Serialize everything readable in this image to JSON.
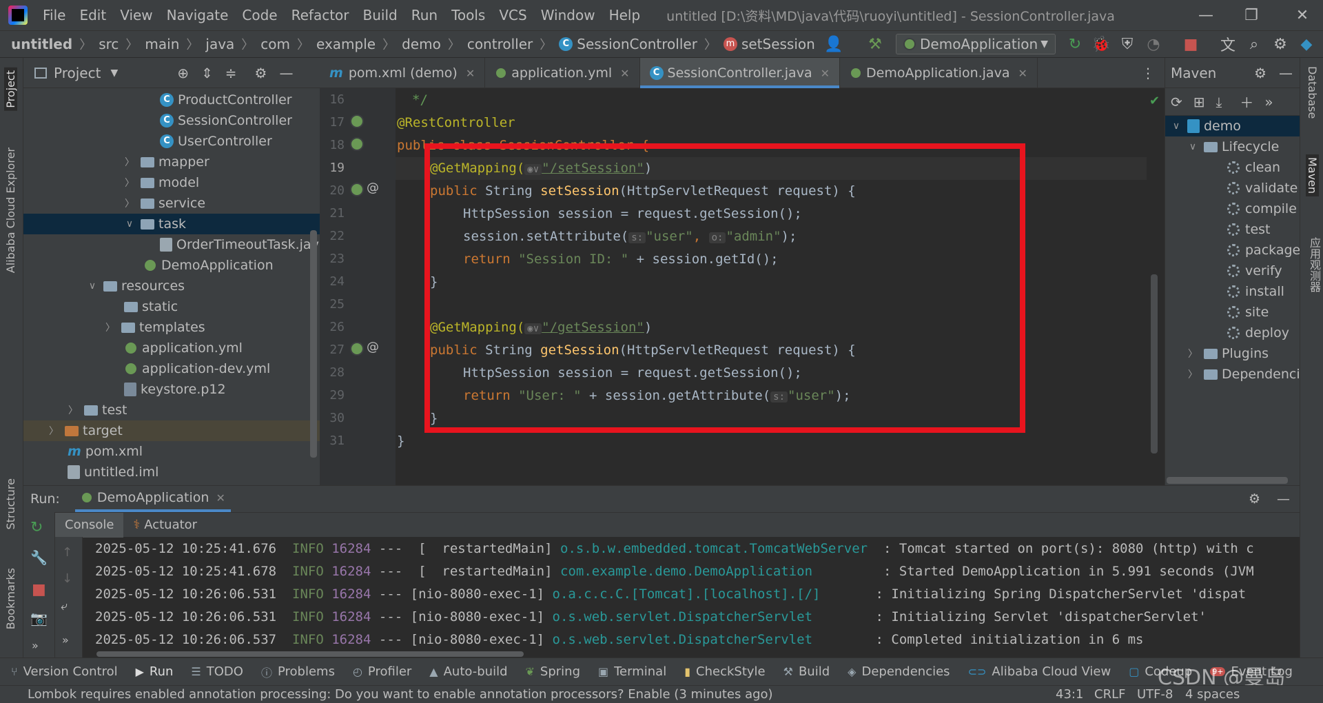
{
  "window": {
    "menu": [
      "File",
      "Edit",
      "View",
      "Navigate",
      "Code",
      "Refactor",
      "Build",
      "Run",
      "Tools",
      "VCS",
      "Window",
      "Help"
    ],
    "title": "untitled [D:\\资料\\MD\\java\\代码\\ruoyi\\untitled] - SessionController.java"
  },
  "breadcrumb": [
    "untitled",
    "src",
    "main",
    "java",
    "com",
    "example",
    "demo",
    "controller",
    "SessionController",
    "setSession"
  ],
  "run_config": "DemoApplication",
  "project_panel": {
    "title": "Project",
    "tree": [
      {
        "label": "ProductController",
        "kind": "class"
      },
      {
        "label": "SessionController",
        "kind": "class"
      },
      {
        "label": "UserController",
        "kind": "class"
      },
      {
        "label": "mapper",
        "kind": "folder"
      },
      {
        "label": "model",
        "kind": "folder"
      },
      {
        "label": "service",
        "kind": "folder"
      },
      {
        "label": "task",
        "kind": "folder"
      },
      {
        "label": "OrderTimeoutTask.jav",
        "kind": "file"
      },
      {
        "label": "DemoApplication",
        "kind": "spring"
      },
      {
        "label": "resources",
        "kind": "folder"
      },
      {
        "label": "static",
        "kind": "folder"
      },
      {
        "label": "templates",
        "kind": "folder"
      },
      {
        "label": "application.yml",
        "kind": "spring"
      },
      {
        "label": "application-dev.yml",
        "kind": "spring"
      },
      {
        "label": "keystore.p12",
        "kind": "file"
      },
      {
        "label": "test",
        "kind": "folder"
      },
      {
        "label": "target",
        "kind": "folder"
      },
      {
        "label": "pom.xml",
        "kind": "maven"
      },
      {
        "label": "untitled.iml",
        "kind": "file"
      }
    ]
  },
  "editor": {
    "tabs": [
      "pom.xml (demo)",
      "application.yml",
      "SessionController.java",
      "DemoApplication.java"
    ],
    "line_numbers": [
      "16",
      "17",
      "18",
      "19",
      "20",
      "21",
      "22",
      "23",
      "24",
      "25",
      "26",
      "27",
      "28",
      "29",
      "30",
      "31"
    ],
    "code": {
      "l16": "*/",
      "l17": "@RestController",
      "l18": "public class SessionController {",
      "l19_a": "@GetMapping(",
      "l19_b": "\"/setSession\"",
      "l19_c": ")",
      "l20_a": "public",
      "l20_b": " String ",
      "l20_c": "setSession",
      "l20_d": "(HttpServletRequest request) {",
      "l21": "HttpSession session = request.getSession();",
      "l22_a": "session.setAttribute(",
      "l22_b": "\"user\"",
      "l22_c": ", ",
      "l22_d": "\"admin\"",
      "l22_e": ");",
      "l23_a": "return",
      "l23_b": " \"Session ID: \"",
      "l23_c": " + session.getId();",
      "l24": "}",
      "l26_a": "@GetMapping(",
      "l26_b": "\"/getSession\"",
      "l26_c": ")",
      "l27_a": "public",
      "l27_b": " String ",
      "l27_c": "getSession",
      "l27_d": "(HttpServletRequest request) {",
      "l28": "HttpSession session = request.getSession();",
      "l29_a": "return",
      "l29_b": " \"User: \"",
      "l29_c": " + session.getAttribute(",
      "l29_d": "\"user\"",
      "l29_e": ");",
      "l30": "}",
      "l31": "}"
    },
    "hints": {
      "s": "s:",
      "o": "o:"
    }
  },
  "maven": {
    "title": "Maven",
    "project": "demo",
    "lifecycle": "Lifecycle",
    "goals": [
      "clean",
      "validate",
      "compile",
      "test",
      "package",
      "verify",
      "install",
      "site",
      "deploy"
    ],
    "plugins": "Plugins",
    "dependencies": "Dependencie"
  },
  "run_panel": {
    "label": "Run:",
    "tab": "DemoApplication",
    "subtabs": [
      "Console",
      "Actuator"
    ],
    "logs": [
      {
        "ts": "2025-05-12 10:25:41.676",
        "lvl": "INFO",
        "pid": "16284",
        "thread": "---  [  restartedMain]",
        "cls": "o.s.b.w.embedded.tomcat.TomcatWebServer ",
        "msg": " : Tomcat started on port(s): 8080 (http) with c"
      },
      {
        "ts": "2025-05-12 10:25:41.678",
        "lvl": "INFO",
        "pid": "16284",
        "thread": "---  [  restartedMain]",
        "cls": "com.example.demo.DemoApplication        ",
        "msg": " : Started DemoApplication in 5.991 seconds (JVM"
      },
      {
        "ts": "2025-05-12 10:26:06.531",
        "lvl": "INFO",
        "pid": "16284",
        "thread": "--- [nio-8080-exec-1]",
        "cls": "o.a.c.c.C.[Tomcat].[localhost].[/]      ",
        "msg": " : Initializing Spring DispatcherServlet 'dispat"
      },
      {
        "ts": "2025-05-12 10:26:06.531",
        "lvl": "INFO",
        "pid": "16284",
        "thread": "--- [nio-8080-exec-1]",
        "cls": "o.s.web.servlet.DispatcherServlet       ",
        "msg": " : Initializing Servlet 'dispatcherServlet'"
      },
      {
        "ts": "2025-05-12 10:26:06.537",
        "lvl": "INFO",
        "pid": "16284",
        "thread": "--- [nio-8080-exec-1]",
        "cls": "o.s.web.servlet.DispatcherServlet       ",
        "msg": " : Completed initialization in 6 ms"
      }
    ]
  },
  "bottom_tools": [
    "Version Control",
    "Run",
    "TODO",
    "Problems",
    "Profiler",
    "Auto-build",
    "Spring",
    "Terminal",
    "CheckStyle",
    "Build",
    "Dependencies",
    "Alibaba Cloud View",
    "Codeup",
    "Event Log"
  ],
  "event_badge": "9+",
  "side_labels": {
    "left": [
      "Project",
      "Alibaba Cloud Explorer",
      "Structure",
      "Bookmarks"
    ],
    "right": [
      "Database",
      "Maven",
      "应用观测器"
    ]
  },
  "status": {
    "message": "Lombok requires enabled annotation processing: Do you want to enable annotation processors? Enable (3 minutes ago)",
    "position": "43:1",
    "line_sep": "CRLF",
    "encoding": "UTF-8",
    "indent": "4 spaces"
  },
  "watermark": "CSDN @曼岛",
  "colors": {
    "accent": "#4a88c7",
    "redbox": "#e8141e",
    "bg": "#2b2b2b",
    "panel": "#3c3f41"
  }
}
